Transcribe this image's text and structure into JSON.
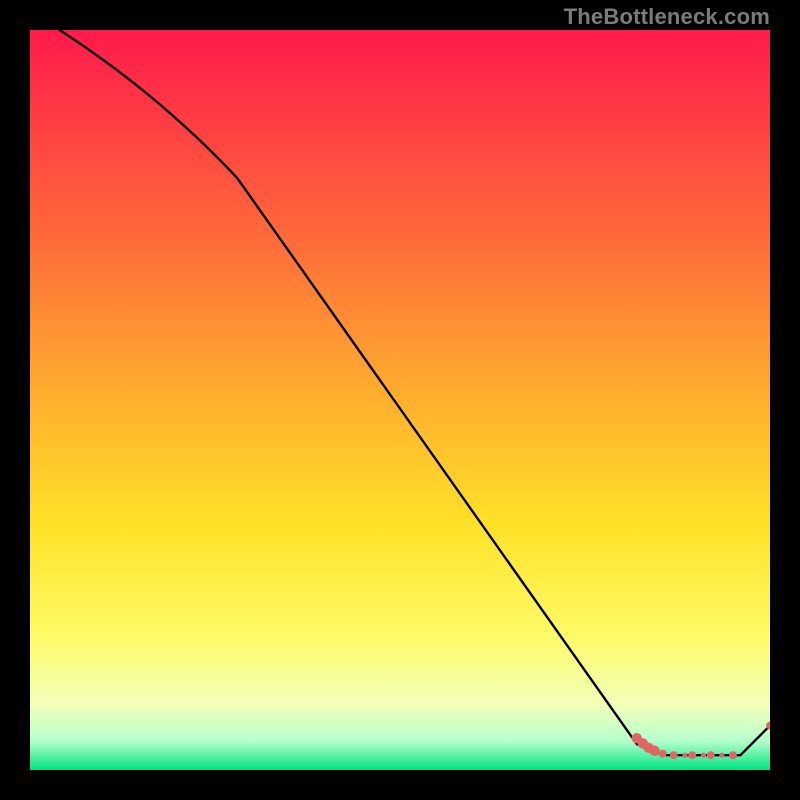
{
  "watermark": "TheBottleneck.com",
  "colors": {
    "top": "#ff1a4b",
    "g1": "#ff6a3a",
    "g2": "#ffb02e",
    "g3": "#ffe228",
    "g4": "#fffb68",
    "g5": "#f3ffb8",
    "g6": "#b8ffcc",
    "bottom": "#00e383",
    "stroke": "#000000",
    "marker": "#e06666",
    "frame": "#000000"
  },
  "chart_data": {
    "type": "line",
    "title": "",
    "xlabel": "",
    "ylabel": "",
    "xlim": [
      0,
      100
    ],
    "ylim": [
      0,
      100
    ],
    "grid": false,
    "series": [
      {
        "name": "bottleneck-curve",
        "x": [
          0,
          4,
          28,
          82,
          84,
          86,
          88,
          90,
          92,
          94,
          96,
          100
        ],
        "y": [
          110,
          100,
          80,
          3.5,
          2.5,
          2,
          2,
          2,
          2,
          2,
          2,
          6
        ]
      }
    ],
    "markers": {
      "name": "optimum-segment",
      "points": [
        {
          "x": 82,
          "y": 4.3,
          "size": "large"
        },
        {
          "x": 82.8,
          "y": 3.6,
          "size": "large"
        },
        {
          "x": 83.6,
          "y": 3.0,
          "size": "large"
        },
        {
          "x": 84.4,
          "y": 2.6,
          "size": "large"
        },
        {
          "x": 85.5,
          "y": 2.2,
          "size": "medium"
        },
        {
          "x": 87,
          "y": 2.0,
          "size": "medium"
        },
        {
          "x": 88.5,
          "y": 2.0,
          "size": "small"
        },
        {
          "x": 89.5,
          "y": 2.0,
          "size": "medium"
        },
        {
          "x": 91,
          "y": 2.0,
          "size": "small"
        },
        {
          "x": 92,
          "y": 2.0,
          "size": "medium"
        },
        {
          "x": 93.5,
          "y": 2.0,
          "size": "small"
        },
        {
          "x": 95,
          "y": 2.0,
          "size": "medium"
        },
        {
          "x": 100,
          "y": 6.0,
          "size": "medium"
        }
      ]
    }
  }
}
